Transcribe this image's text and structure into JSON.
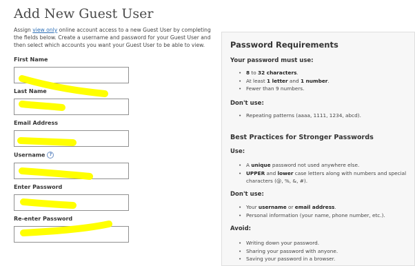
{
  "page": {
    "title": "Add New Guest User",
    "intro": {
      "before": "Assign ",
      "link": "view only",
      "after": " online account access to a new Guest User by completing the fields below. Create a username and password for your Guest User and then select which accounts you want your Guest User to be able to view."
    }
  },
  "form": {
    "fields": [
      {
        "label": "First Name",
        "value": ""
      },
      {
        "label": "Last Name",
        "value": ""
      },
      {
        "label": "Email Address",
        "value": ""
      },
      {
        "label": "Username",
        "value": "",
        "help_icon": "?"
      },
      {
        "label": "Enter Password",
        "value": ""
      },
      {
        "label": "Re-enter Password",
        "value": ""
      }
    ],
    "redaction_color": "#ffff00"
  },
  "requirements": {
    "title": "Password Requirements",
    "must_use": {
      "heading": "Your password must use:",
      "items": [
        {
          "b1": "8",
          "t1": " to ",
          "b2": "32 characters",
          "t2": ".",
          "b3": "",
          "t3": ""
        },
        {
          "b1": "",
          "t1": "At least ",
          "b2": "1 letter",
          "t2": " and ",
          "b3": "1 number",
          "t3": "."
        },
        {
          "b1": "",
          "t1": "Fewer than 9 numbers.",
          "b2": "",
          "t2": "",
          "b3": "",
          "t3": ""
        }
      ]
    },
    "dont_use": {
      "heading": "Don't use:",
      "items": [
        {
          "text": "Repeating patterns (aaaa, 1111, 1234, abcd)."
        }
      ]
    },
    "best_practices": {
      "heading": "Best Practices for Stronger Passwords",
      "use_heading": "Use:",
      "use_items": [
        {
          "b1": "",
          "t1": "A ",
          "b2": "unique",
          "t2": " password not used anywhere else.",
          "b3": "",
          "t3": "",
          "b4": "",
          "t4": ""
        },
        {
          "b1": "UPPER",
          "t1": " and ",
          "b2": "lower",
          "t2": " case letters along with numbers and special characters (@, %, &, #).",
          "b3": "",
          "t3": "",
          "b4": "",
          "t4": ""
        }
      ],
      "dont_heading": "Don't use:",
      "dont_items": [
        {
          "b1": "",
          "t1": "Your ",
          "b2": "username",
          "t2": " or ",
          "b3": "email address",
          "t3": ".",
          "b4": "",
          "t4": ""
        },
        {
          "b1": "",
          "t1": "Personal information (your name, phone number, etc.).",
          "b2": "",
          "t2": "",
          "b3": "",
          "t3": "",
          "b4": "",
          "t4": ""
        }
      ],
      "avoid_heading": "Avoid:",
      "avoid_items": [
        {
          "text": "Writing down your password."
        },
        {
          "text": "Sharing your password with anyone."
        },
        {
          "text": "Saving your password in a browser."
        }
      ]
    }
  }
}
